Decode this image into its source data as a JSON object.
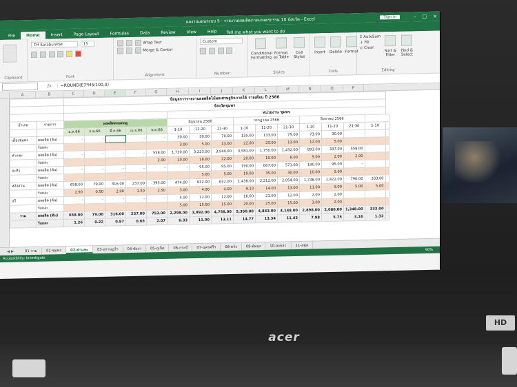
{
  "window": {
    "title": "ผลงานแผนระบบ 5 - รายงานผลผลิตภาคเกษตรกรรม 10 จังหวัด - Excel",
    "signin": "Sign in",
    "controls": [
      "–",
      "□",
      "×"
    ]
  },
  "ribbon_tabs": [
    "File",
    "Home",
    "Insert",
    "Page Layout",
    "Formulas",
    "Data",
    "Review",
    "View",
    "Help"
  ],
  "active_tab": "Home",
  "tell_me": "Tell me what you want to do",
  "ribbon": {
    "clipboard_label": "Clipboard",
    "font_name": "TH SarabunPSK",
    "font_size": "15",
    "font_label": "Font",
    "wrap_text": "Wrap Text",
    "merge_center": "Merge & Center",
    "alignment_label": "Alignment",
    "number_format": "Custom",
    "number_label": "Number",
    "conditional": "Conditional Formatting",
    "format_table": "Format as Table",
    "cell_styles": "Cell Styles",
    "styles_label": "Styles",
    "insert": "Insert",
    "delete": "Delete",
    "format": "Format",
    "cells_label": "Cells",
    "autosum": "AutoSum",
    "fill": "Fill",
    "clear": "Clear",
    "sort_filter": "Sort & Filter",
    "find_select": "Find & Select",
    "editing_label": "Editing"
  },
  "formula_bar": {
    "name_box": "",
    "formula": "=ROUND(E7*H6/100,0)"
  },
  "columns": [
    "A",
    "B",
    "C",
    "D",
    "E",
    "F",
    "G",
    "H",
    "I",
    "J",
    "K",
    "L",
    "M",
    "N",
    "O",
    "P"
  ],
  "sheet": {
    "title": "ข้อมูลการรายงานผลผลิตไม้ผลเศรษฐกิจภาคใต้ รายเดือน ปี 2566",
    "province": "จังหวัดชุมพร",
    "district": "หน่วยงาน ชุมพร",
    "head_col1": "อำเภอ",
    "head_col2": "รายการ",
    "green_header": "ผลผลิตตลอดฤดู",
    "green_subs": [
      "ม.ค.66",
      "ก.พ.66",
      "มี.ค.66",
      "เม.ย.66",
      "พ.ค.66"
    ],
    "months": [
      "มิถุนายน 2566",
      "กรกฎาคม 2566",
      "สิงหาคม 2566"
    ],
    "periods": [
      "1-10",
      "11-20",
      "21-30"
    ],
    "rows": [
      {
        "district": "เมืองชุมพร",
        "item": "ผลผลิต (ตัน)",
        "vals": [
          "-",
          "-",
          "-",
          "-",
          "-",
          "30.00",
          "30.00",
          "70.00",
          "135.00",
          "133.00",
          "75.00",
          "73.00",
          "30.00",
          "",
          ""
        ]
      },
      {
        "district": "",
        "item": "ร้อยละ",
        "vals": [
          "",
          "",
          "",
          "",
          "",
          "3.00",
          "5.00",
          "13.00",
          "22.00",
          "25.00",
          "13.00",
          "12.00",
          "5.00",
          "",
          ""
        ]
      },
      {
        "district": "ท่าแซะ",
        "item": "ผลผลิต (ตัน)",
        "vals": [
          "-",
          "-",
          "-",
          "-",
          "558.00",
          "1,730.00",
          "3,223.00",
          "3,940.00",
          "3,581.00",
          "1,750.00",
          "1,432.00",
          "893.00",
          "337.00",
          "558.00",
          ""
        ]
      },
      {
        "district": "",
        "item": "ร้อยละ",
        "vals": [
          "",
          "",
          "",
          "",
          "2.00",
          "10.00",
          "18.00",
          "22.00",
          "20.00",
          "10.00",
          "8.00",
          "5.00",
          "2.00",
          "2.00",
          ""
        ]
      },
      {
        "district": "ปะทิว",
        "item": "ผลผลิต (ตัน)",
        "vals": [
          "-",
          "-",
          "-",
          "-",
          "-",
          "-",
          "95.00",
          "95.00",
          "190.00",
          "667.00",
          "571.00",
          "190.00",
          "95.00",
          "-",
          ""
        ]
      },
      {
        "district": "",
        "item": "ร้อยละ",
        "vals": [
          "",
          "",
          "",
          "",
          "",
          "",
          "5.00",
          "5.00",
          "10.00",
          "35.00",
          "30.00",
          "10.00",
          "5.00",
          "",
          ""
        ]
      },
      {
        "district": "หลังสวน",
        "item": "ผลผลิต (ตัน)",
        "vals": [
          "658.00",
          "79.00",
          "316.00",
          "237.00",
          "395.00",
          "474.00",
          "632.00",
          "632.00",
          "1,438.00",
          "2,212.00",
          "2,054.00",
          "1,738.00",
          "1,422.00",
          "790.00",
          "333.00"
        ]
      },
      {
        "district": "",
        "item": "ร้อยละ",
        "vals": [
          "2.90",
          "0.50",
          "2.00",
          "1.50",
          "2.50",
          "3.00",
          "4.00",
          "4.00",
          "9.10",
          "14.00",
          "13.00",
          "11.00",
          "9.00",
          "5.00",
          "5.00"
        ]
      },
      {
        "district": "สวี",
        "item": "ผลผลิต (ตัน)",
        "vals": [
          "-",
          "-",
          "-",
          "-",
          "-",
          "4.00",
          "12.00",
          "12.00",
          "16.00",
          "21.00",
          "12.00",
          "2.00",
          "2.00",
          "",
          ""
        ]
      },
      {
        "district": "",
        "item": "ร้อยละ",
        "vals": [
          "",
          "",
          "",
          "",
          "",
          "5.00",
          "15.00",
          "15.00",
          "20.00",
          "25.00",
          "15.00",
          "3.00",
          "2.00",
          "",
          ""
        ]
      }
    ],
    "total": {
      "label": "รวม",
      "item": "ผลผลิต (ตัน)",
      "vals": [
        "658.00",
        "79.00",
        "316.00",
        "237.00",
        "753.00",
        "2,298.00",
        "3,992.00",
        "4,758.00",
        "5,360.00",
        "4,843.00",
        "4,148.00",
        "2,898.00",
        "2,086.00",
        "1,348.00",
        "333.00"
      ]
    },
    "total_pct": {
      "item": "ร้อยละ",
      "vals": [
        "1.26",
        "0.22",
        "0.87",
        "0.65",
        "2.07",
        "6.33",
        "11.00",
        "13.11",
        "14.77",
        "13.34",
        "11.43",
        "7.98",
        "5.75",
        "3.16",
        "1.32"
      ]
    }
  },
  "sheet_tabs": [
    "01-รวม",
    "01-ชุมพร",
    "02-ท่าแซะ",
    "03-สุราษฎร์ฯ",
    "04-พังงา",
    "05-ภูเก็ต",
    "06-กระบี่",
    "07-นครศรีฯ",
    "08-ตรัง",
    "09-พัทลุง",
    "10-สงขลา",
    "11-สตูล"
  ],
  "active_sheet": "02-ท่าแซะ",
  "status": {
    "left": "Accessibility: Investigate",
    "zoom": "90%"
  },
  "laptop_brand": "acer",
  "badge": "HD"
}
